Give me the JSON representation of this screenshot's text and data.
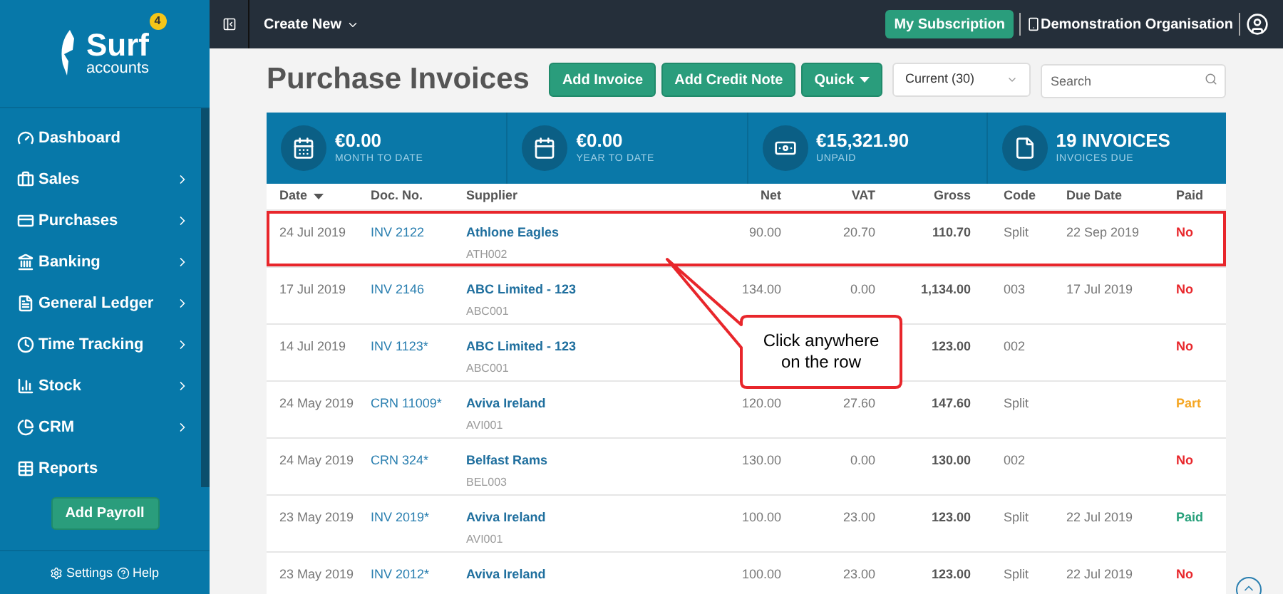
{
  "sidebar": {
    "logo": {
      "name": "Surf",
      "sub": "accounts",
      "badge": "4"
    },
    "items": [
      {
        "label": "Dashboard",
        "expandable": false
      },
      {
        "label": "Sales",
        "expandable": true
      },
      {
        "label": "Purchases",
        "expandable": true
      },
      {
        "label": "Banking",
        "expandable": true
      },
      {
        "label": "General Ledger",
        "expandable": true
      },
      {
        "label": "Time Tracking",
        "expandable": true
      },
      {
        "label": "Stock",
        "expandable": true
      },
      {
        "label": "CRM",
        "expandable": true
      },
      {
        "label": "Reports",
        "expandable": false
      }
    ],
    "action_button": "Add Payroll",
    "footer": [
      "Settings",
      "Help"
    ]
  },
  "topbar": {
    "create_menu": "Create New",
    "subscription_button": "My Subscription",
    "organisation": "Demonstration Organisation"
  },
  "page": {
    "title": "Purchase Invoices",
    "buttons": [
      "Add Invoice",
      "Add Credit Note"
    ],
    "quick_button": "Quick",
    "filter": "Current (30)",
    "search": {
      "placeholder": "Search"
    }
  },
  "stats": [
    {
      "value": "€0.00",
      "label": "MONTH TO DATE"
    },
    {
      "value": "€0.00",
      "label": "YEAR TO DATE"
    },
    {
      "value": "€15,321.90",
      "label": "UNPAID"
    },
    {
      "value": "19 INVOICES",
      "label": "INVOICES DUE"
    }
  ],
  "table": {
    "columns": [
      {
        "label": "Date",
        "sorted": true
      },
      {
        "label": "Doc. No.",
        "sorted": false
      },
      {
        "label": "Supplier",
        "sorted": false
      },
      {
        "label": "Net",
        "sorted": false
      },
      {
        "label": "VAT",
        "sorted": false
      },
      {
        "label": "Gross",
        "sorted": false
      },
      {
        "label": "Code",
        "sorted": false
      },
      {
        "label": "Due Date",
        "sorted": false
      },
      {
        "label": "Paid",
        "sorted": false
      }
    ],
    "rows": [
      {
        "date": "24 Jul 2019",
        "doc": "INV 2122",
        "supplier": "Athlone Eagles",
        "supplier_code": "ATH002",
        "net": "90.00",
        "vat": "20.70",
        "gross": "110.70",
        "code": "Split",
        "due": "22 Sep 2019",
        "paid": "No",
        "color": "#e8262b",
        "highlighted": true
      },
      {
        "date": "17 Jul 2019",
        "doc": "INV 2146",
        "supplier": "ABC Limited - 123",
        "supplier_code": "ABC001",
        "net": "134.00",
        "vat": "0.00",
        "gross": "1,134.00",
        "code": "003",
        "due": "17 Jul 2019",
        "paid": "No",
        "color": "#e8262b",
        "highlighted": false
      },
      {
        "date": "14 Jul 2019",
        "doc": "INV 1123*",
        "supplier": "ABC Limited - 123",
        "supplier_code": "ABC001",
        "gross": "123.00",
        "code": "002",
        "paid": "No",
        "color": "#e8262b",
        "highlighted": false
      },
      {
        "date": "24 May 2019",
        "doc": "CRN 11009*",
        "supplier": "Aviva Ireland",
        "supplier_code": "AVI001",
        "net": "120.00",
        "vat": "27.60",
        "gross": "147.60",
        "code": "Split",
        "paid": "Part",
        "color": "#f5a623",
        "highlighted": false
      },
      {
        "date": "24 May 2019",
        "doc": "CRN 324*",
        "supplier": "Belfast Rams",
        "supplier_code": "BEL003",
        "net": "130.00",
        "vat": "0.00",
        "gross": "130.00",
        "code": "002",
        "paid": "No",
        "color": "#e8262b",
        "highlighted": false
      },
      {
        "date": "23 May 2019",
        "doc": "INV 2019*",
        "supplier": "Aviva Ireland",
        "supplier_code": "AVI001",
        "net": "100.00",
        "vat": "23.00",
        "gross": "123.00",
        "code": "Split",
        "due": "22 Jul 2019",
        "paid": "Paid",
        "color": "#26a07a",
        "highlighted": false
      },
      {
        "date": "23 May 2019",
        "doc": "INV 2012*",
        "supplier": "Aviva Ireland",
        "net": "100.00",
        "vat": "23.00",
        "gross": "123.00",
        "code": "Split",
        "due": "22 Jul 2019",
        "paid": "No",
        "color": "#e8262b",
        "highlighted": false
      }
    ]
  },
  "callout": {
    "text": "Click anywhere on the row"
  }
}
